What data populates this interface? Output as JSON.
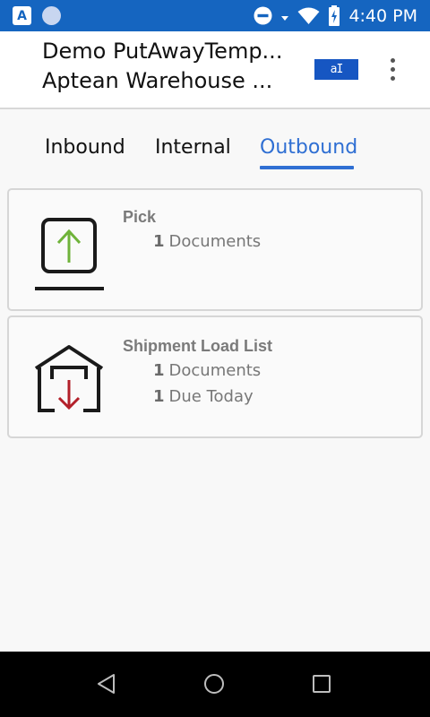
{
  "status_bar": {
    "time": "4:40 PM",
    "left_icons": [
      "a-app-icon",
      "circle-app-icon"
    ],
    "right_icons": [
      "do-not-disturb-icon",
      "wifi-icon",
      "battery-icon"
    ],
    "a_label": "A",
    "color": "#1565c0"
  },
  "app_bar": {
    "title_line1": "Demo PutAwayTemp...",
    "title_line2": "Aptean Warehouse ...",
    "keyboard_icon_label": "aI",
    "menu_icon": "more-vertical-icon"
  },
  "tabs": [
    {
      "label": "Inbound",
      "active": false
    },
    {
      "label": "Internal",
      "active": false
    },
    {
      "label": "Outbound",
      "active": true
    }
  ],
  "accent_color": "#2f6fd3",
  "cards": {
    "pick": {
      "title": "Pick",
      "documents_count": "1",
      "documents_label": "Documents",
      "icon": "upload-box-icon"
    },
    "shipment": {
      "title": "Shipment Load List",
      "documents_count": "1",
      "documents_label": "Documents",
      "due_count": "1",
      "due_label": "Due Today",
      "icon": "warehouse-outbound-icon"
    }
  },
  "nav_bar": {
    "buttons": [
      "back-icon",
      "home-icon",
      "recents-icon"
    ]
  }
}
